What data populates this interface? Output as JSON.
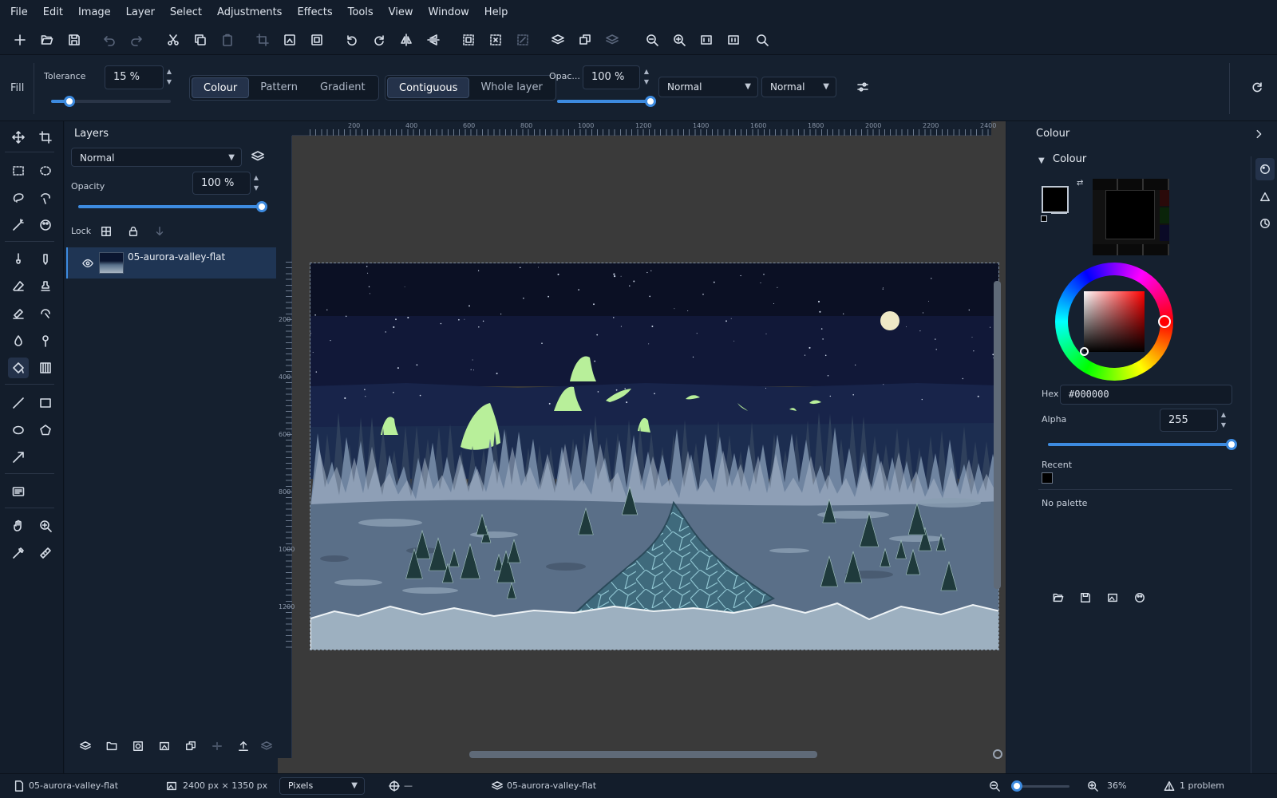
{
  "menu": [
    "File",
    "Edit",
    "Image",
    "Layer",
    "Select",
    "Adjustments",
    "Effects",
    "Tools",
    "View",
    "Window",
    "Help"
  ],
  "toolbar_icons": [
    "new-icon",
    "open-icon",
    "save-icon",
    "undo-icon",
    "redo-icon",
    "cut-icon",
    "copy-icon",
    "paste-icon",
    "crop-icon",
    "resize-image-icon",
    "resize-canvas-icon",
    "rotate-ccw-icon",
    "rotate-cw-icon",
    "flip-horizontal-icon",
    "flip-vertical-icon",
    "select-all-icon",
    "deselect-icon",
    "invert-selection-icon",
    "add-layer-icon",
    "duplicate-layer-icon",
    "delete-layer-icon",
    "zoom-out-icon",
    "zoom-in-icon",
    "best-fit-icon",
    "actual-size-icon",
    "search-icon"
  ],
  "options": {
    "tool_name": "Fill",
    "tolerance_label": "Tolerance",
    "tolerance_value": "15 %",
    "tolerance_fraction": 0.15,
    "fill_modes": [
      "Colour",
      "Pattern",
      "Gradient"
    ],
    "fill_mode_active": 0,
    "flood_modes": [
      "Contiguous",
      "Whole layer"
    ],
    "flood_mode_active": 0,
    "opacity_label": "Opac...",
    "opacity_value": "100 %",
    "opacity_fraction": 1.0,
    "blend_mode_1": "Normal",
    "blend_mode_2": "Normal"
  },
  "layers": {
    "title": "Layers",
    "blend_mode": "Normal",
    "opacity_label": "Opacity",
    "opacity_value": "100 %",
    "opacity_fraction": 1.0,
    "lock_label": "Lock",
    "items": [
      {
        "name": "05-aurora-valley-flat",
        "visible": true
      }
    ]
  },
  "ruler_h": [
    "200",
    "400",
    "600",
    "800",
    "1000",
    "1200",
    "1400",
    "1600",
    "1800",
    "2000",
    "2200",
    "2400"
  ],
  "ruler_v": [
    "200",
    "400",
    "600",
    "800",
    "1000",
    "1200"
  ],
  "colour_panel": {
    "title": "Colour",
    "section": "Colour",
    "primary_color": "#000000",
    "secondary_color": "#ffffff",
    "hex_label": "Hex",
    "hex_value": "#000000",
    "alpha_label": "Alpha",
    "alpha_value": "255",
    "alpha_fraction": 1.0,
    "recent_label": "Recent",
    "recent_colors": [
      "#000000"
    ],
    "palette_label": "No palette"
  },
  "status": {
    "document": "05-aurora-valley-flat",
    "image_size": "2400 px × 1350 px",
    "units": "Pixels",
    "cursor": "—",
    "layer": "05-aurora-valley-flat",
    "zoom": "36%",
    "zoom_fraction": 0.05,
    "problems": "1 problem"
  },
  "colors": {
    "accent": "#3d8be0",
    "panel": "#15202f",
    "canvas_bg": "#3a3a3a"
  }
}
